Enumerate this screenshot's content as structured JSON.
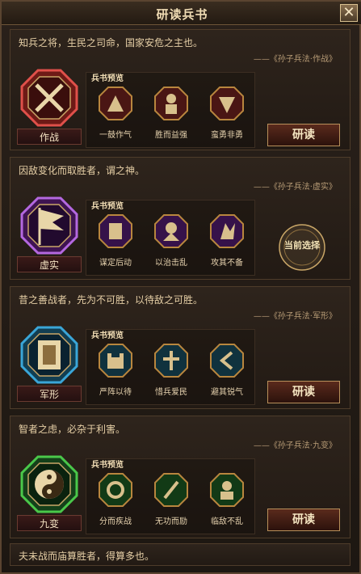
{
  "header": {
    "title": "研读兵书"
  },
  "colors": {
    "red": "#b4342b",
    "purple": "#8d38b5",
    "blue": "#2e8db8",
    "green": "#3fa83f",
    "gold": "#c9a667"
  },
  "sections": [
    {
      "quote": "知兵之将，生民之司命，国家安危之主也。",
      "source": "——《孙子兵法·作战》",
      "medal_name": "作战",
      "medal_icon": "crossed-swords-icon",
      "preview_label": "兵书预览",
      "skills": [
        {
          "label": "一鼓作气",
          "icon": "warrior-charge-icon"
        },
        {
          "label": "胜而益强",
          "icon": "armored-general-icon"
        },
        {
          "label": "蛮勇非勇",
          "icon": "shield-slash-icon"
        }
      ],
      "action": "研读"
    },
    {
      "quote": "因敌变化而取胜者，谓之神。",
      "source": "——《孙子兵法·虚实》",
      "medal_name": "虚实",
      "medal_icon": "battle-flag-icon",
      "preview_label": "兵书预览",
      "skills": [
        {
          "label": "谋定后动",
          "icon": "strategist-icon"
        },
        {
          "label": "以治击乱",
          "icon": "formation-strike-icon"
        },
        {
          "label": "攻其不备",
          "icon": "ambush-icon"
        }
      ],
      "action": "当前选择"
    },
    {
      "quote": "昔之善战者，先为不可胜，以待敌之可胜。",
      "source": "——《孙子兵法·军形》",
      "medal_name": "军形",
      "medal_icon": "army-formation-icon",
      "preview_label": "兵书预览",
      "skills": [
        {
          "label": "严阵以待",
          "icon": "fortress-icon"
        },
        {
          "label": "惜兵爱民",
          "icon": "healing-icon"
        },
        {
          "label": "避其锐气",
          "icon": "evade-icon"
        }
      ],
      "action": "研读"
    },
    {
      "quote": "智者之虑，必杂于利害。",
      "source": "——《孙子兵法·九变》",
      "medal_name": "九变",
      "medal_icon": "yin-yang-icon",
      "preview_label": "兵书预览",
      "skills": [
        {
          "label": "分而疾战",
          "icon": "ring-split-icon"
        },
        {
          "label": "无功而励",
          "icon": "raised-weapon-icon"
        },
        {
          "label": "临敌不乱",
          "icon": "calm-general-icon"
        }
      ],
      "action": "研读"
    }
  ],
  "footer": {
    "text": "夫未战而庙算胜者，得算多也。"
  }
}
